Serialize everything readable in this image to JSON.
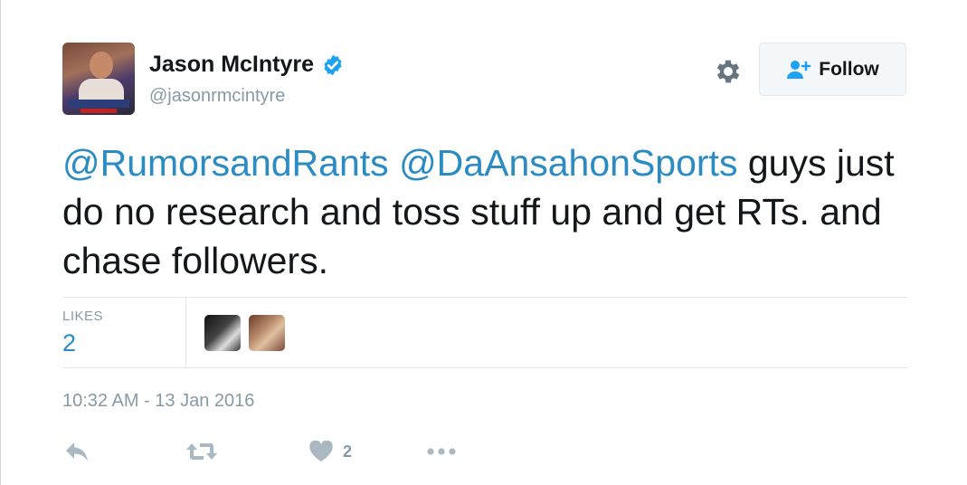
{
  "user": {
    "name": "Jason McIntyre",
    "handle": "@jasonrmcintyre",
    "verified": true
  },
  "follow_button": {
    "label": "Follow"
  },
  "tweet": {
    "mentions": [
      "@RumorsandRants",
      "@DaAnsahonSports"
    ],
    "body": " guys just do no research and toss stuff up and get RTs. and chase followers."
  },
  "stats": {
    "likes_label": "LIKES",
    "likes_value": "2"
  },
  "timestamp": "10:32 AM - 13 Jan 2016",
  "actions": {
    "like_count": "2"
  },
  "icons": [
    "verified-icon",
    "gear-icon",
    "add-user-icon",
    "reply-icon",
    "retweet-icon",
    "heart-icon",
    "more-icon"
  ],
  "colors": {
    "accent": "#2b8cc4",
    "text": "#14171a",
    "muted": "#8899a6",
    "verified": "#1da1f2"
  }
}
